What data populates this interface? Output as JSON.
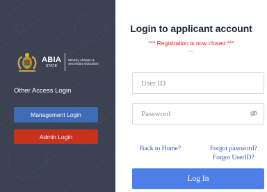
{
  "branding": {
    "name": "ABIA",
    "state": "STATE",
    "ministry": "Ministry of Basic & Secondary Education"
  },
  "sidebar": {
    "heading": "Other Access Login",
    "management_button": "Management Login",
    "admin_button": "Admin Login"
  },
  "login": {
    "title": "Login to applicant account",
    "notice": "*** Registration is now closed ***",
    "ellipsis": "...",
    "userid_placeholder": "User ID",
    "password_placeholder": "Password",
    "back_home": "Back to Home?",
    "forgot_password": "Forgot password?",
    "forgot_userid": "Forgot UserID?",
    "submit": "Log In"
  },
  "colors": {
    "sidebar_bg": "#3c4251",
    "management_button": "#3f6bb6",
    "admin_button": "#c8321d",
    "notice": "#e31b1b",
    "link": "#2b59a7",
    "submit_button": "#4d7fe6"
  },
  "icons": {
    "crest": "abia-crest-icon",
    "password_toggle": "eye-icon"
  }
}
